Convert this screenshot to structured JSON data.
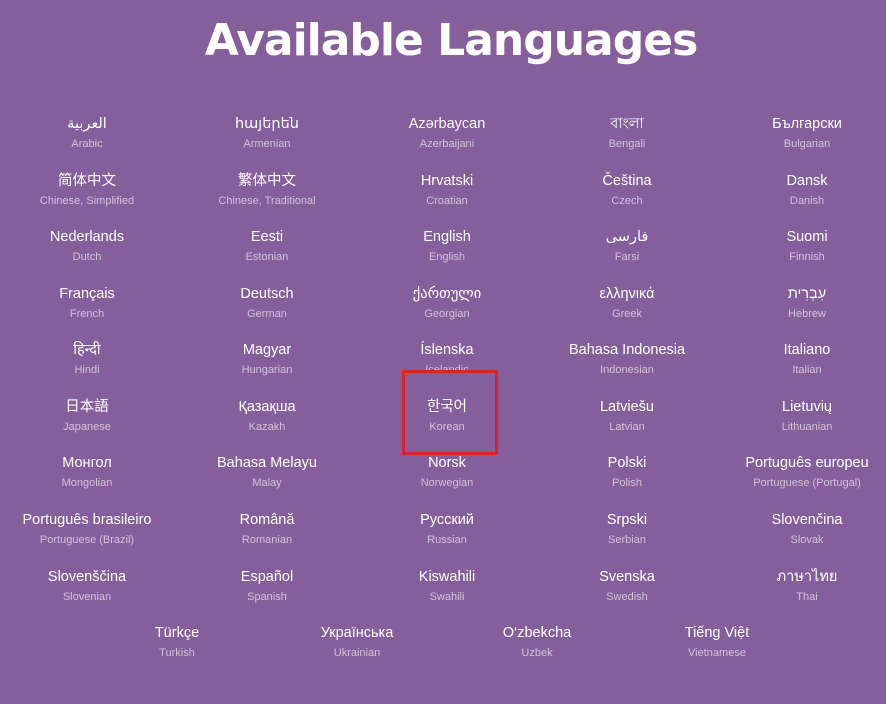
{
  "title": "Available Languages",
  "languages": [
    {
      "native": "العربية",
      "english": "Arabic"
    },
    {
      "native": "հայերեն",
      "english": "Armenian"
    },
    {
      "native": "Azərbaycan",
      "english": "Azerbaijani"
    },
    {
      "native": "বাংলা",
      "english": "Bengali"
    },
    {
      "native": "Български",
      "english": "Bulgarian"
    },
    {
      "native": "简体中文",
      "english": "Chinese, Simplified"
    },
    {
      "native": "繁体中文",
      "english": "Chinese, Traditional"
    },
    {
      "native": "Hrvatski",
      "english": "Croatian"
    },
    {
      "native": "Čeština",
      "english": "Czech"
    },
    {
      "native": "Dansk",
      "english": "Danish"
    },
    {
      "native": "Nederlands",
      "english": "Dutch"
    },
    {
      "native": "Eesti",
      "english": "Estonian"
    },
    {
      "native": "English",
      "english": "English"
    },
    {
      "native": "فارسی",
      "english": "Farsi"
    },
    {
      "native": "Suomi",
      "english": "Finnish"
    },
    {
      "native": "Français",
      "english": "French"
    },
    {
      "native": "Deutsch",
      "english": "German"
    },
    {
      "native": "ქართული",
      "english": "Georgian"
    },
    {
      "native": "ελληνικά",
      "english": "Greek"
    },
    {
      "native": "עִבְרִית",
      "english": "Hebrew"
    },
    {
      "native": "हिन्दी",
      "english": "Hindi"
    },
    {
      "native": "Magyar",
      "english": "Hungarian"
    },
    {
      "native": "Íslenska",
      "english": "Icelandic"
    },
    {
      "native": "Bahasa Indonesia",
      "english": "Indonesian"
    },
    {
      "native": "Italiano",
      "english": "Italian"
    },
    {
      "native": "日本語",
      "english": "Japanese"
    },
    {
      "native": "Қазақша",
      "english": "Kazakh"
    },
    {
      "native": "한국어",
      "english": "Korean"
    },
    {
      "native": "Latviešu",
      "english": "Latvian"
    },
    {
      "native": "Lietuvių",
      "english": "Lithuanian"
    },
    {
      "native": "Монгол",
      "english": "Mongolian"
    },
    {
      "native": "Bahasa Melayu",
      "english": "Malay"
    },
    {
      "native": "Norsk",
      "english": "Norwegian"
    },
    {
      "native": "Polski",
      "english": "Polish"
    },
    {
      "native": "Português europeu",
      "english": "Portuguese (Portugal)"
    },
    {
      "native": "Português brasileiro",
      "english": "Portuguese (Brazil)"
    },
    {
      "native": "Română",
      "english": "Romanian"
    },
    {
      "native": "Русский",
      "english": "Russian"
    },
    {
      "native": "Srpski",
      "english": "Serbian"
    },
    {
      "native": "Slovenčina",
      "english": "Slovak"
    },
    {
      "native": "Slovenščina",
      "english": "Slovenian"
    },
    {
      "native": "Español",
      "english": "Spanish"
    },
    {
      "native": "Kiswahili",
      "english": "Swahili"
    },
    {
      "native": "Svenska",
      "english": "Swedish"
    },
    {
      "native": "ภาษาไทย",
      "english": "Thai"
    },
    {
      "native": "Türkçe",
      "english": "Turkish"
    },
    {
      "native": "Українська",
      "english": "Ukrainian"
    },
    {
      "native": "O‘zbekcha",
      "english": "Uzbek"
    },
    {
      "native": "Tiếng Việt",
      "english": "Vietnamese"
    }
  ],
  "highlighted": "Korean",
  "colors": {
    "background": "#855f9b",
    "text": "#ffffff",
    "subtext": "#d3c3dc",
    "highlight": "#d8232a"
  }
}
